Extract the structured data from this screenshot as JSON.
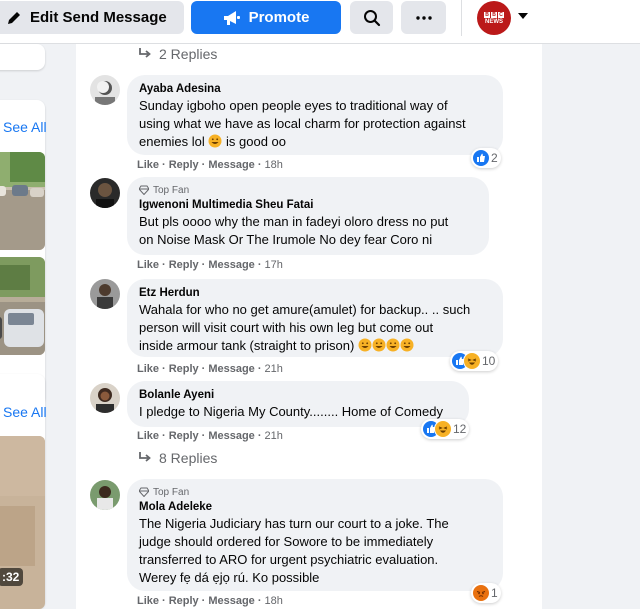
{
  "topbar": {
    "edit_send_message": "Edit Send Message",
    "promote": "Promote",
    "search_icon": "search-icon",
    "more_icon": "more-options",
    "page_avatar_text": "BBC NEWS",
    "bbc_letters": [
      "B",
      "B",
      "C"
    ],
    "bbc_word": "NEWS"
  },
  "left": {
    "see_all_1": "See All",
    "see_all_2": "See All",
    "video_duration": ":32"
  },
  "replies_top": "2 Replies",
  "replies_mid": "8 Replies",
  "labels": {
    "like": "Like",
    "reply": "Reply",
    "message": "Message",
    "dot": "·",
    "top_fan": "Top Fan"
  },
  "colors": {
    "primary": "#1877f2",
    "bubble": "#f0f2f5",
    "background": "#f0f2f5",
    "bbc_red": "#bb1919"
  },
  "comments": [
    {
      "name": "Ayaba Adesina",
      "lines": [
        "Sunday igboho open people eyes to traditional way of",
        "using what we have as local charm for protection against",
        "enemies lol",
        "is good oo"
      ],
      "time": "18h",
      "reaction_count": "2"
    },
    {
      "badge": "Top Fan",
      "name": "Igwenoni Multimedia Sheu Fatai",
      "lines": [
        "But pls oooo why the man in fadeyi oloro dress no put",
        "on Noise Mask Or The Irumole No dey fear Coro ni"
      ],
      "time": "17h"
    },
    {
      "name": "Etz Herdun",
      "lines": [
        "Wahala for who no get amure(amulet) for backup.. .. such",
        "person will visit court with his own leg but come out",
        "inside armour tank (straight to prison)"
      ],
      "time": "21h",
      "reaction_count": "10"
    },
    {
      "name": "Bolanle Ayeni",
      "lines": [
        "I pledge to Nigeria My County........ Home of Comedy"
      ],
      "time": "21h",
      "reaction_count": "12"
    },
    {
      "badge": "Top Fan",
      "name": "Mola Adeleke",
      "lines": [
        "The Nigeria Judiciary has turn our court to a joke. The",
        "judge should ordered for Sowore to be immediately",
        "transferred to ARO for urgent psychiatric evaluation.",
        "Werey fẹ dá ẹjọ rú. Ko possible"
      ],
      "time": "18h",
      "reaction_count": "1"
    }
  ]
}
